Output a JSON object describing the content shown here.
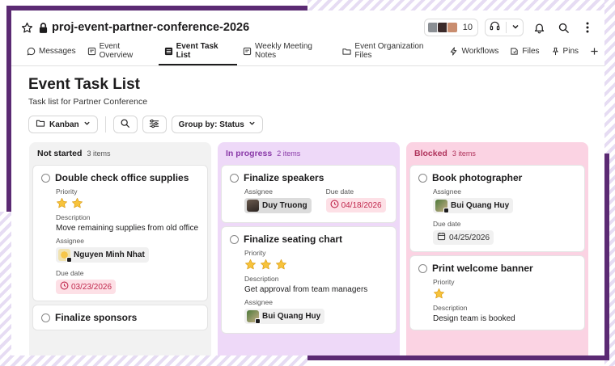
{
  "channel": {
    "title": "proj-event-partner-conference-2026",
    "member_count": "10"
  },
  "tabs": [
    {
      "label": "Messages",
      "icon": "chat-bubble-icon"
    },
    {
      "label": "Event Overview",
      "icon": "canvas-icon"
    },
    {
      "label": "Event Task List",
      "icon": "list-icon",
      "active": true
    },
    {
      "label": "Weekly Meeting Notes",
      "icon": "canvas-icon"
    },
    {
      "label": "Event Organization Files",
      "icon": "folder-icon"
    },
    {
      "label": "Workflows",
      "icon": "lightning-icon"
    },
    {
      "label": "Files",
      "icon": "files-icon"
    },
    {
      "label": "Pins",
      "icon": "pin-icon"
    }
  ],
  "page": {
    "title": "Event Task List",
    "subtitle": "Task list for Partner Conference"
  },
  "toolbar": {
    "view_label": "Kanban",
    "group_label": "Group by: Status"
  },
  "columns": [
    {
      "name": "Not started",
      "count": "3 items",
      "cards": [
        {
          "title": "Double check office supplies",
          "priority_label": "Priority",
          "description_label": "Description",
          "description": "Move remaining supplies from old office",
          "assignee_label": "Assignee",
          "assignee": "Nguyen Minh Nhat",
          "due_label": "Due date",
          "due": "03/23/2026"
        },
        {
          "title": "Finalize sponsors"
        }
      ]
    },
    {
      "name": "In progress",
      "count": "2 items",
      "cards": [
        {
          "title": "Finalize speakers",
          "assignee_label": "Assignee",
          "assignee": "Duy Truong",
          "due_label": "Due date",
          "due": "04/18/2026"
        },
        {
          "title": "Finalize seating chart",
          "priority_label": "Priority",
          "description_label": "Description",
          "description": "Get approval from team managers",
          "assignee_label": "Assignee",
          "assignee": "Bui Quang Huy"
        }
      ]
    },
    {
      "name": "Blocked",
      "count": "3 items",
      "cards": [
        {
          "title": "Book photographer",
          "assignee_label": "Assignee",
          "assignee": "Bui Quang Huy",
          "due_label": "Due date",
          "due": "04/25/2026"
        },
        {
          "title": "Print welcome banner",
          "priority_label": "Priority",
          "description_label": "Description",
          "description": "Design team is booked"
        }
      ]
    }
  ],
  "ratings": {
    "double_check_office_supplies": 2,
    "finalize_seating_chart": 3,
    "print_welcome_banner": 1
  },
  "colors": {
    "accent_purple": "#5b2a73",
    "star_yellow": "#f7c33c",
    "due_red": "#c0284d"
  }
}
